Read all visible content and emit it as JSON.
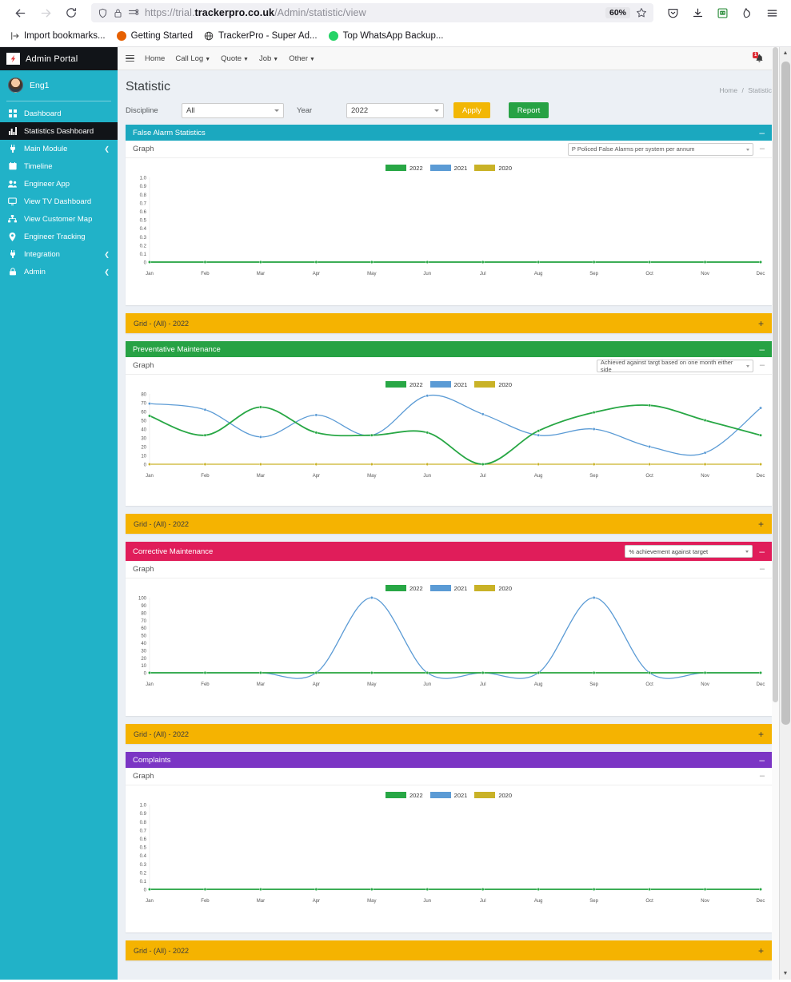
{
  "browser": {
    "url_prefix": "https://trial.",
    "url_domain": "trackerpro.co.uk",
    "url_path": "/Admin/statistic/view",
    "zoom_level": "60%",
    "back_icon": "back-arrow-icon",
    "forward_icon": "forward-arrow-icon",
    "reload_icon": "reload-icon",
    "shield_icon": "shield-icon",
    "lock_icon": "padlock-icon",
    "reader_icon": "reader-mode-icon",
    "bookmark_star_icon": "star-icon",
    "pocket_icon": "pocket-icon",
    "downloads_icon": "download-icon",
    "extension_icon": "extension-icon",
    "container_icon": "container-tabs-icon",
    "menu_icon": "hamburger-menu-icon",
    "bookmarks": [
      {
        "label": "Import bookmarks...",
        "icon": "import-icon",
        "color": "#4b4b4b"
      },
      {
        "label": "Getting Started",
        "icon": "firefox-icon",
        "color": "#e66000"
      },
      {
        "label": "TrackerPro - Super Ad...",
        "icon": "globe-icon",
        "color": "#3a3a3a"
      },
      {
        "label": "Top WhatsApp Backup...",
        "icon": "whatsapp-icon",
        "color": "#25d366"
      }
    ]
  },
  "sidebar": {
    "brand": "Admin Portal",
    "brand_logo_icon": "lightning-bolt-icon",
    "user": "Eng1",
    "bg_color": "#21b2c8",
    "active_bg": "#111418",
    "items": [
      {
        "label": "Dashboard",
        "icon": "grid-icon",
        "active": false,
        "caret": false
      },
      {
        "label": "Statistics Dashboard",
        "icon": "bar-chart-icon",
        "active": true,
        "caret": false
      },
      {
        "label": "Main Module",
        "icon": "plug-icon",
        "active": false,
        "caret": true
      },
      {
        "label": "Timeline",
        "icon": "calendar-icon",
        "active": false,
        "caret": false
      },
      {
        "label": "Engineer App",
        "icon": "users-icon",
        "active": false,
        "caret": false
      },
      {
        "label": "View TV Dashboard",
        "icon": "monitor-icon",
        "active": false,
        "caret": false
      },
      {
        "label": "View Customer Map",
        "icon": "sitemap-icon",
        "active": false,
        "caret": false
      },
      {
        "label": "Engineer Tracking",
        "icon": "map-pin-icon",
        "active": false,
        "caret": false
      },
      {
        "label": "Integration",
        "icon": "plug-icon",
        "active": false,
        "caret": true
      },
      {
        "label": "Admin",
        "icon": "lock-icon",
        "active": false,
        "caret": true
      }
    ]
  },
  "topnav": {
    "menu_icon": "hamburger-menu-icon",
    "links": [
      {
        "label": "Home",
        "dropdown": false
      },
      {
        "label": "Call Log",
        "dropdown": true
      },
      {
        "label": "Quote",
        "dropdown": true
      },
      {
        "label": "Job",
        "dropdown": true
      },
      {
        "label": "Other",
        "dropdown": true
      }
    ],
    "notification_icon": "bell-icon",
    "notification_badge": "1",
    "logout_icon": "logout-icon"
  },
  "page": {
    "title": "Statistic",
    "breadcrumb_home": "Home",
    "breadcrumb_sep": "/",
    "breadcrumb_current": "Statistic"
  },
  "filters": {
    "discipline_label": "Discipline",
    "discipline_value": "All",
    "year_label": "Year",
    "year_value": "2022",
    "apply_label": "Apply",
    "report_label": "Report",
    "apply_color": "#f2b705",
    "report_color": "#27a244"
  },
  "labels": {
    "graph": "Graph",
    "minimize": "–",
    "expand": "+",
    "grid_title": "Grid - (All) - 2022"
  },
  "legend": [
    {
      "label": "2022",
      "color": "#28a745"
    },
    {
      "label": "2021",
      "color": "#5b9bd5"
    },
    {
      "label": "2020",
      "color": "#c9b227"
    }
  ],
  "panels": [
    {
      "title": "False Alarm Statistics",
      "color": "#1ba8bf",
      "select_in_header": false,
      "select_value": "P Policed False Alarms per system per annum",
      "grid_title": "Grid - (All) - 2022"
    },
    {
      "title": "Preventative Maintenance",
      "color": "#27a244",
      "select_in_header": false,
      "select_value": "Achieved against targt based on one month either side",
      "grid_title": "Grid - (All) - 2022"
    },
    {
      "title": "Corrective Maintenance",
      "color": "#e01d5a",
      "select_in_header": true,
      "select_value": "% achievement against target",
      "grid_title": "Grid - (All) - 2022"
    },
    {
      "title": "Complaints",
      "color": "#7b35c4",
      "select_in_header": false,
      "select_value": "",
      "grid_title": "Grid - (All) - 2022"
    }
  ],
  "chart_data": [
    {
      "type": "line",
      "title": "False Alarm Statistics",
      "subtitle": "P Policed False Alarms per system per annum",
      "categories": [
        "Jan",
        "Feb",
        "Mar",
        "Apr",
        "May",
        "Jun",
        "Jul",
        "Aug",
        "Sep",
        "Oct",
        "Nov",
        "Dec"
      ],
      "series": [
        {
          "name": "2022",
          "color": "#28a745",
          "values": [
            0,
            0,
            0,
            0,
            0,
            0,
            0,
            0,
            0,
            0,
            0,
            0
          ]
        },
        {
          "name": "2021",
          "color": "#5b9bd5",
          "values": [
            0,
            0,
            0,
            0,
            0,
            0,
            0,
            0,
            0,
            0,
            0,
            0
          ]
        },
        {
          "name": "2020",
          "color": "#c9b227",
          "values": [
            0,
            0,
            0,
            0,
            0,
            0,
            0,
            0,
            0,
            0,
            0,
            0
          ]
        }
      ],
      "yticks": [
        1.0,
        0.9,
        0.8,
        0.7,
        0.6,
        0.5,
        0.4,
        0.3,
        0.2,
        0.1,
        0
      ],
      "ytick_labels": [
        "1.0",
        "0.9",
        "0.8",
        "0.7",
        "0.6",
        "0.5",
        "0.4",
        "0.3",
        "0.2",
        "0.1",
        "0"
      ],
      "ylim": [
        0,
        1.0
      ],
      "xlabel": "",
      "ylabel": "",
      "grid": false,
      "legend_position": "top-center"
    },
    {
      "type": "line",
      "title": "Preventative Maintenance",
      "subtitle": "Achieved against targt based on one month either side",
      "categories": [
        "Jan",
        "Feb",
        "Mar",
        "Apr",
        "May",
        "Jun",
        "Jul",
        "Aug",
        "Sep",
        "Oct",
        "Nov",
        "Dec"
      ],
      "series": [
        {
          "name": "2022",
          "color": "#28a745",
          "values": [
            55,
            33,
            65,
            36,
            33,
            36,
            0,
            38,
            59,
            67,
            50,
            33
          ]
        },
        {
          "name": "2021",
          "color": "#5b9bd5",
          "values": [
            69,
            62,
            31,
            56,
            33,
            78,
            57,
            33,
            40,
            20,
            13,
            64
          ]
        },
        {
          "name": "2020",
          "color": "#c9b227",
          "values": [
            0,
            0,
            0,
            0,
            0,
            0,
            0,
            0,
            0,
            0,
            0,
            0
          ]
        }
      ],
      "yticks": [
        80,
        70,
        60,
        50,
        40,
        30,
        20,
        10,
        0
      ],
      "ytick_labels": [
        "80",
        "70",
        "60",
        "50",
        "40",
        "30",
        "20",
        "10",
        "0"
      ],
      "ylim": [
        0,
        80
      ],
      "xlabel": "",
      "ylabel": "",
      "grid": false,
      "legend_position": "top-center"
    },
    {
      "type": "line",
      "title": "Corrective Maintenance",
      "subtitle": "% achievement against target",
      "categories": [
        "Jan",
        "Feb",
        "Mar",
        "Apr",
        "May",
        "Jun",
        "Jul",
        "Aug",
        "Sep",
        "Oct",
        "Nov",
        "Dec"
      ],
      "series": [
        {
          "name": "2022",
          "color": "#28a745",
          "values": [
            0,
            0,
            0,
            0,
            0,
            0,
            0,
            0,
            0,
            0,
            0,
            0
          ]
        },
        {
          "name": "2021",
          "color": "#5b9bd5",
          "values": [
            0,
            0,
            0,
            0,
            100,
            0,
            0,
            0,
            100,
            0,
            0,
            0
          ]
        },
        {
          "name": "2020",
          "color": "#c9b227",
          "values": [
            0,
            0,
            0,
            0,
            0,
            0,
            0,
            0,
            0,
            0,
            0,
            0
          ]
        }
      ],
      "yticks": [
        100,
        90,
        80,
        70,
        60,
        50,
        40,
        30,
        20,
        10,
        0
      ],
      "ytick_labels": [
        "100",
        "90",
        "80",
        "70",
        "60",
        "50",
        "40",
        "30",
        "20",
        "10",
        "0"
      ],
      "ylim": [
        0,
        100
      ],
      "xlabel": "",
      "ylabel": "",
      "grid": false,
      "legend_position": "top-center"
    },
    {
      "type": "line",
      "title": "Complaints",
      "subtitle": "",
      "categories": [
        "Jan",
        "Feb",
        "Mar",
        "Apr",
        "May",
        "Jun",
        "Jul",
        "Aug",
        "Sep",
        "Oct",
        "Nov",
        "Dec"
      ],
      "series": [
        {
          "name": "2022",
          "color": "#28a745",
          "values": [
            0,
            0,
            0,
            0,
            0,
            0,
            0,
            0,
            0,
            0,
            0,
            0
          ]
        },
        {
          "name": "2021",
          "color": "#5b9bd5",
          "values": [
            0,
            0,
            0,
            0,
            0,
            0,
            0,
            0,
            0,
            0,
            0,
            0
          ]
        },
        {
          "name": "2020",
          "color": "#c9b227",
          "values": [
            0,
            0,
            0,
            0,
            0,
            0,
            0,
            0,
            0,
            0,
            0,
            0
          ]
        }
      ],
      "yticks": [
        1.0,
        0.9,
        0.8,
        0.7,
        0.6,
        0.5,
        0.4,
        0.3,
        0.2,
        0.1,
        0
      ],
      "ytick_labels": [
        "1.0",
        "0.9",
        "0.8",
        "0.7",
        "0.6",
        "0.5",
        "0.4",
        "0.3",
        "0.2",
        "0.1",
        "0"
      ],
      "ylim": [
        0,
        1.0
      ],
      "xlabel": "",
      "ylabel": "",
      "grid": false,
      "legend_position": "top-center"
    }
  ]
}
